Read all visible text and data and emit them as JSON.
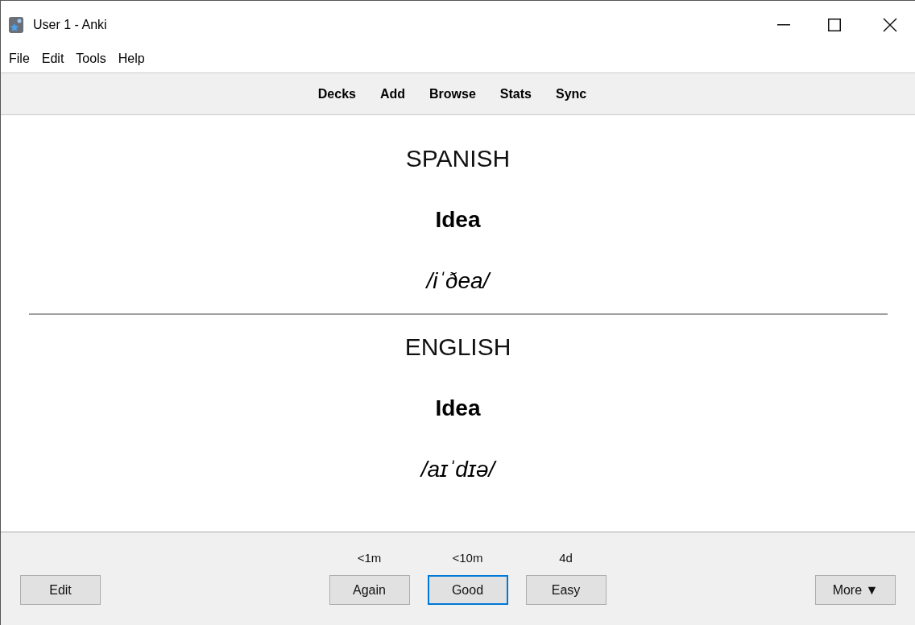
{
  "window": {
    "title": "User 1 - Anki"
  },
  "menu": [
    "File",
    "Edit",
    "Tools",
    "Help"
  ],
  "toolbar": [
    "Decks",
    "Add",
    "Browse",
    "Stats",
    "Sync"
  ],
  "card": {
    "front": [
      {
        "kind": "label",
        "text": "SPANISH"
      },
      {
        "kind": "word",
        "text": "Idea"
      },
      {
        "kind": "pronunciation",
        "text": "/iˈðea/"
      }
    ],
    "back": [
      {
        "kind": "label",
        "text": "ENGLISH"
      },
      {
        "kind": "word",
        "text": "Idea"
      },
      {
        "kind": "pronunciation",
        "text": "/aɪˈdɪə/"
      }
    ]
  },
  "bottom_bar": {
    "edit_button": "Edit",
    "answers": [
      {
        "interval": "<1m",
        "label": "Again",
        "focused": false
      },
      {
        "interval": "<10m",
        "label": "Good",
        "focused": true
      },
      {
        "interval": "4d",
        "label": "Easy",
        "focused": false
      }
    ],
    "more_button": "More ▼"
  }
}
